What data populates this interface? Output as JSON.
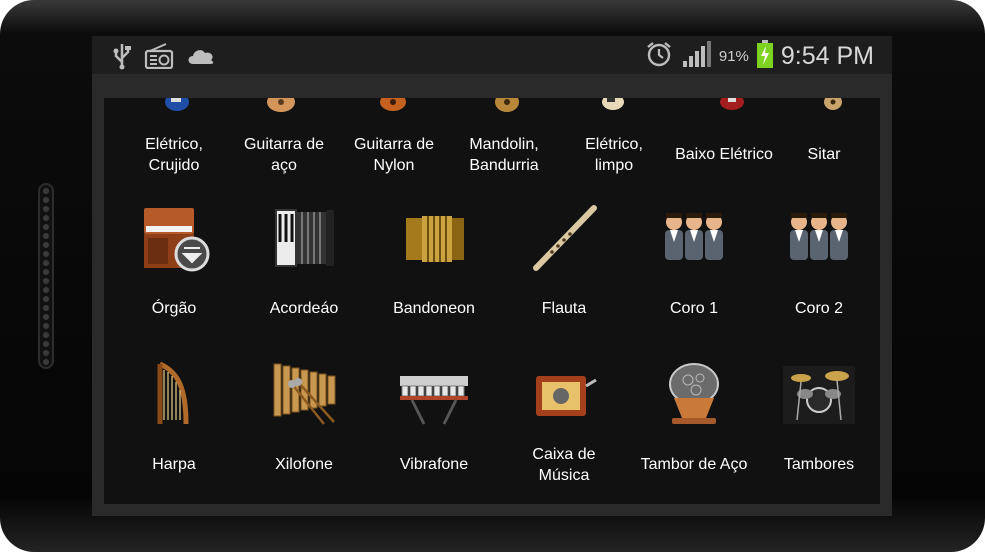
{
  "status_bar": {
    "time": "9:54 PM",
    "battery_percent": "91%",
    "left_icons": [
      "usb-icon",
      "radio-icon",
      "cloud-icon"
    ],
    "right_icons": [
      "alarm-icon",
      "signal-icon",
      "battery-charging-icon"
    ]
  },
  "instruments": {
    "row1": [
      {
        "label": "Elétrico,\nCrujido"
      },
      {
        "label": "Guitarra de\naço"
      },
      {
        "label": "Guitarra de\nNylon"
      },
      {
        "label": "Mandolin,\nBandurria"
      },
      {
        "label": "Elétrico,\nlimpo"
      },
      {
        "label": "Baixo Elétrico"
      },
      {
        "label": "Sitar"
      }
    ],
    "row2": [
      {
        "label": "Órgão"
      },
      {
        "label": "Acordeáo"
      },
      {
        "label": "Bandoneon"
      },
      {
        "label": "Flauta"
      },
      {
        "label": "Coro 1"
      },
      {
        "label": "Coro 2"
      }
    ],
    "row3": [
      {
        "label": "Harpa"
      },
      {
        "label": "Xilofone"
      },
      {
        "label": "Vibrafone"
      },
      {
        "label": "Caixa de\nMúsica"
      },
      {
        "label": "Tambor de Aço"
      },
      {
        "label": "Tambores"
      }
    ]
  },
  "colors": {
    "screen_bg": "#111111",
    "status_bg": "#1e1e1e",
    "battery_green": "#7ed321"
  }
}
